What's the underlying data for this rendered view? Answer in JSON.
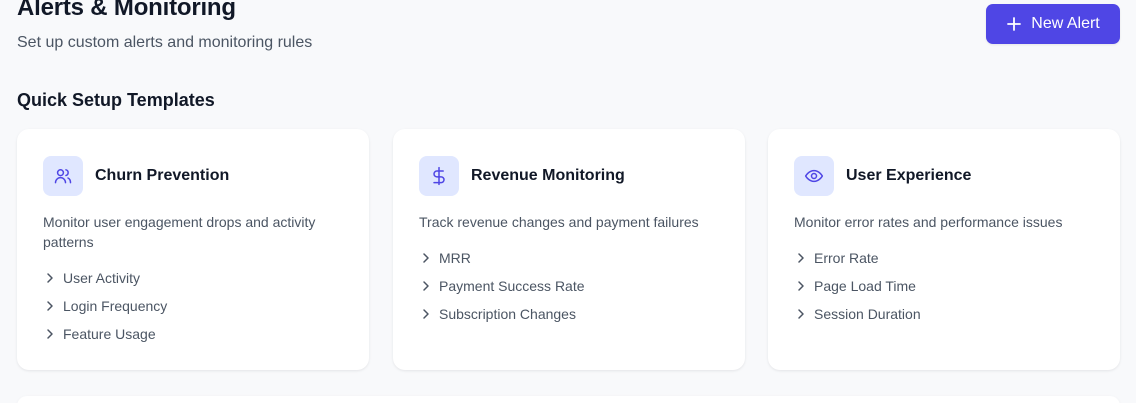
{
  "header": {
    "title": "Alerts & Monitoring",
    "subtitle": "Set up custom alerts and monitoring rules",
    "new_alert_label": "New Alert"
  },
  "templates_section": {
    "title": "Quick Setup Templates",
    "cards": [
      {
        "icon": "users-icon",
        "title": "Churn Prevention",
        "description": "Monitor user engagement drops and activity patterns",
        "metrics": [
          "User Activity",
          "Login Frequency",
          "Feature Usage"
        ]
      },
      {
        "icon": "dollar-icon",
        "title": "Revenue Monitoring",
        "description": "Track revenue changes and payment failures",
        "metrics": [
          "MRR",
          "Payment Success Rate",
          "Subscription Changes"
        ]
      },
      {
        "icon": "eye-icon",
        "title": "User Experience",
        "description": "Monitor error rates and performance issues",
        "metrics": [
          "Error Rate",
          "Page Load Time",
          "Session Duration"
        ]
      }
    ]
  },
  "colors": {
    "accent": "#4f46e5",
    "icon_bg": "#e0e7ff",
    "background": "#f8f9fb"
  }
}
